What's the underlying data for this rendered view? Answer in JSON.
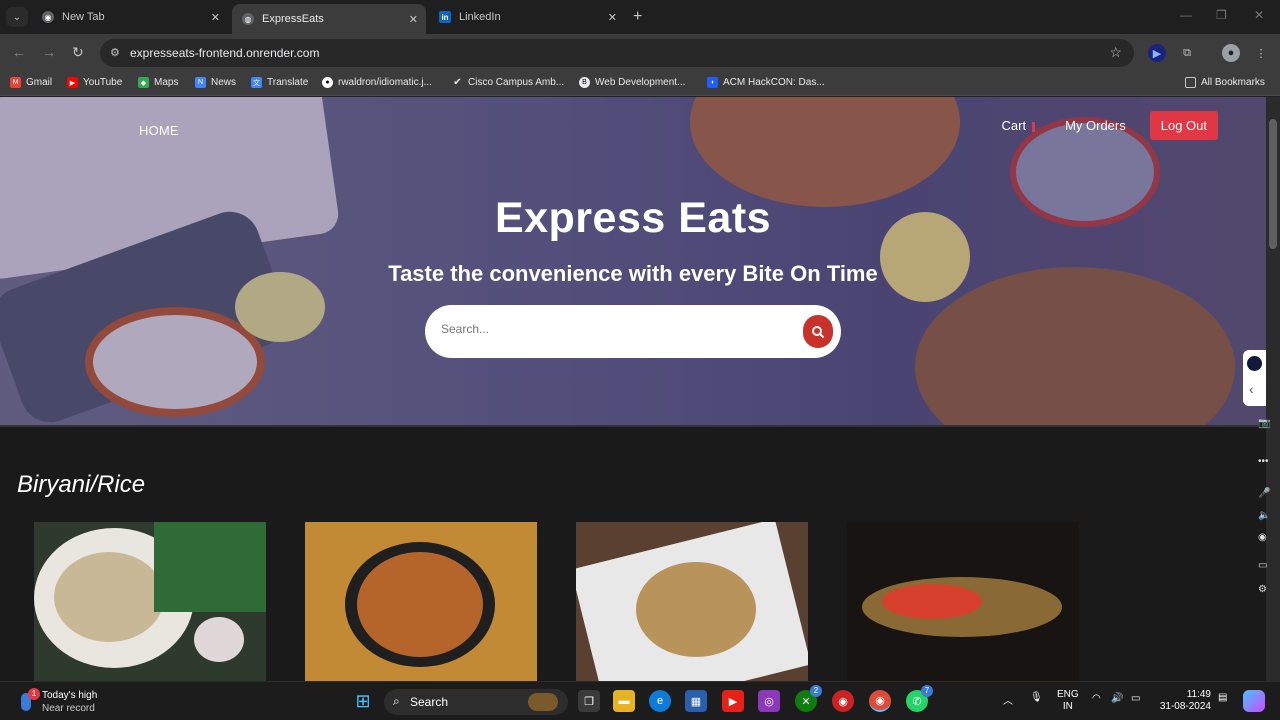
{
  "browser": {
    "tabs": [
      {
        "label": "New Tab",
        "active": false
      },
      {
        "label": "ExpressEats",
        "active": true
      },
      {
        "label": "LinkedIn",
        "active": false
      }
    ],
    "url": "expresseats-frontend.onrender.com",
    "bookmarks": [
      "Gmail",
      "YouTube",
      "Maps",
      "News",
      "Translate",
      "rwaldron/idiomatic.j...",
      "Cisco Campus Amb...",
      "Web Development...",
      "ACM HackCON: Das..."
    ],
    "all_bookmarks": "All Bookmarks"
  },
  "site": {
    "nav": {
      "home": "HOME",
      "cart": "Cart",
      "orders": "My Orders",
      "logout": "Log Out"
    },
    "hero": {
      "title": "Express Eats",
      "subtitle": "Taste the convenience with every Bite On Time",
      "search_placeholder": "Search..."
    },
    "section_title": "Biryani/Rice",
    "accent_color": "#e23744"
  },
  "taskbar": {
    "weather_title": "Today's high",
    "weather_sub": "Near record",
    "weather_badge": "1",
    "search_label": "Search",
    "lang_top": "ENG",
    "lang_bottom": "IN",
    "time": "11:49",
    "date": "31-08-2024",
    "xbox_badge": "2",
    "whatsapp_badge": "7"
  }
}
